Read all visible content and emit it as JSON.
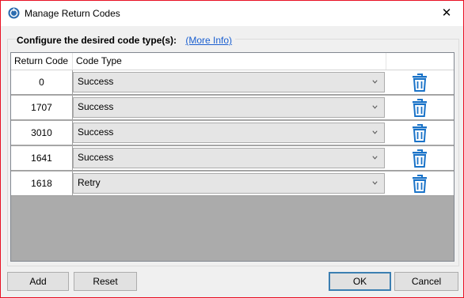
{
  "window": {
    "title": "Manage Return Codes"
  },
  "group": {
    "label": "Configure the desired code type(s):",
    "more_info": "(More Info)"
  },
  "table": {
    "columns": [
      "Return Code",
      "Code Type"
    ],
    "rows": [
      {
        "code": "0",
        "type": "Success"
      },
      {
        "code": "1707",
        "type": "Success"
      },
      {
        "code": "3010",
        "type": "Success"
      },
      {
        "code": "1641",
        "type": "Success"
      },
      {
        "code": "1618",
        "type": "Retry"
      }
    ]
  },
  "buttons": {
    "add": "Add",
    "reset": "Reset",
    "ok": "OK",
    "cancel": "Cancel"
  },
  "colors": {
    "accent": "#1a73c8",
    "border": "#e81123",
    "link": "#1a5fd0"
  }
}
